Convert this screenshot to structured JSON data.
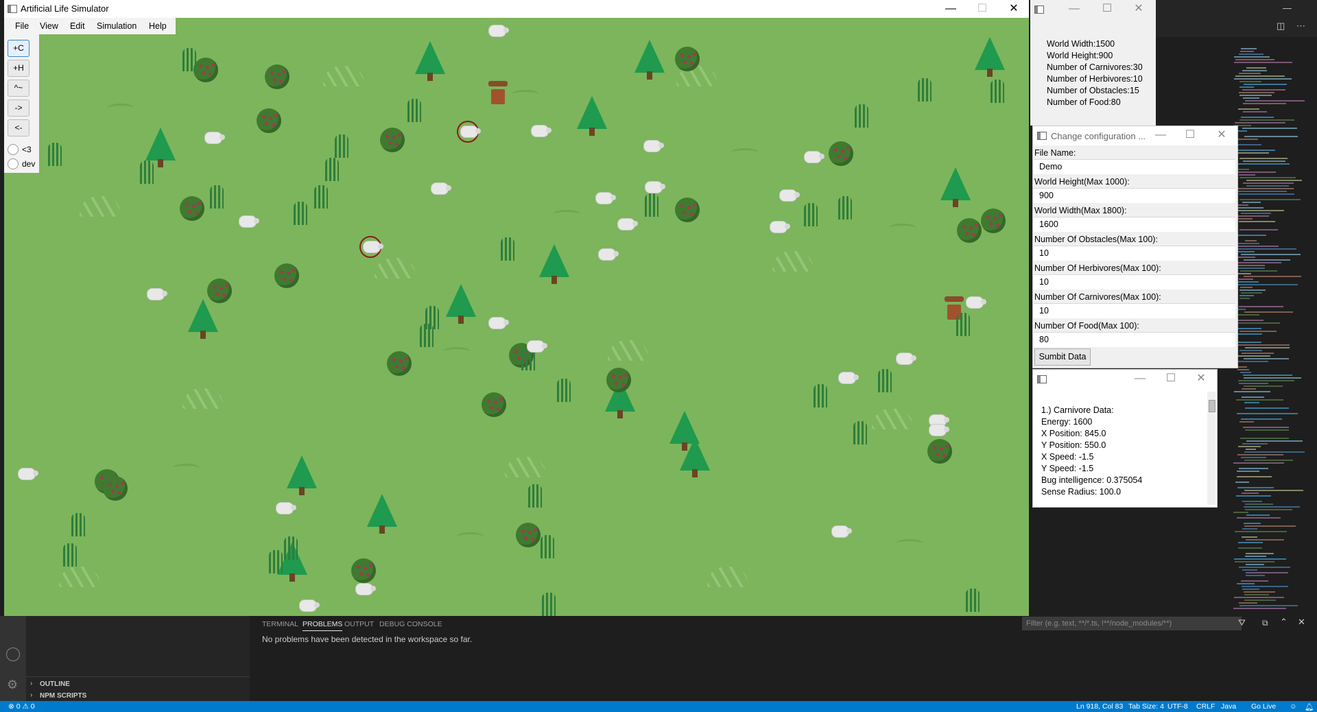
{
  "sim_window": {
    "title": "Artificial Life Simulator",
    "controls": [
      "—",
      "☐",
      "✕"
    ],
    "menus": [
      "File",
      "View",
      "Edit",
      "Simulation",
      "Help"
    ],
    "tool_buttons": [
      "+C",
      "+H",
      "^~",
      "->",
      "<-"
    ],
    "radios": [
      "<3",
      "dev"
    ]
  },
  "info_window": {
    "controls": [
      "—",
      "☐",
      "✕"
    ],
    "lines": [
      "World Width:1500",
      "World Height:900",
      "Number of Carnivores:30",
      "Number of Herbivores:10",
      "Number of Obstacles:15",
      "Number of Food:80"
    ]
  },
  "config_window": {
    "title": "Change configuration ...",
    "controls": [
      "—",
      "☐",
      "✕"
    ],
    "fields": [
      {
        "label": "File Name:",
        "value": "Demo"
      },
      {
        "label": "World Height(Max 1000):",
        "value": "900"
      },
      {
        "label": "World Width(Max 1800):",
        "value": "1600"
      },
      {
        "label": "Number Of Obstacles(Max 100):",
        "value": "10"
      },
      {
        "label": "Number Of Herbivores(Max 100):",
        "value": "10"
      },
      {
        "label": "Number Of Carnivores(Max 100):",
        "value": "10"
      },
      {
        "label": "Number Of Food(Max 100):",
        "value": "80"
      }
    ],
    "submit_label": "Sumbit Data"
  },
  "carnivore_window": {
    "controls": [
      "—",
      "☐",
      "✕"
    ],
    "lines": [
      "1.) Carnivore Data:",
      "Energy: 1600",
      "X Position: 845.0",
      "Y Position: 550.0",
      "X Speed: -1.5",
      "Y Speed: -1.5",
      "Bug intelligence: 0.375054",
      "Sense Radius: 100.0"
    ]
  },
  "panel": {
    "tabs": [
      "TERMINAL",
      "PROBLEMS",
      "OUTPUT",
      "DEBUG CONSOLE"
    ],
    "active_tab": "PROBLEMS",
    "message": "No problems have been detected in the workspace so far.",
    "filter_placeholder": "Filter (e.g. text, **/*.ts, !**/node_modules/**)",
    "side_sections": [
      "OUTLINE",
      "NPM SCRIPTS"
    ]
  },
  "status_bar": {
    "left": "⊗ 0 ⚠ 0",
    "items": [
      "Ln 918, Col 83",
      "Tab Size: 4",
      "UTF-8",
      "CRLF",
      "Java",
      "Go Live"
    ]
  },
  "colors": {
    "world_green": "#7cb55c",
    "status_blue": "#007acc",
    "tree_green": "#1f9a4e",
    "carnivore_ring": "#8b1b1b"
  }
}
